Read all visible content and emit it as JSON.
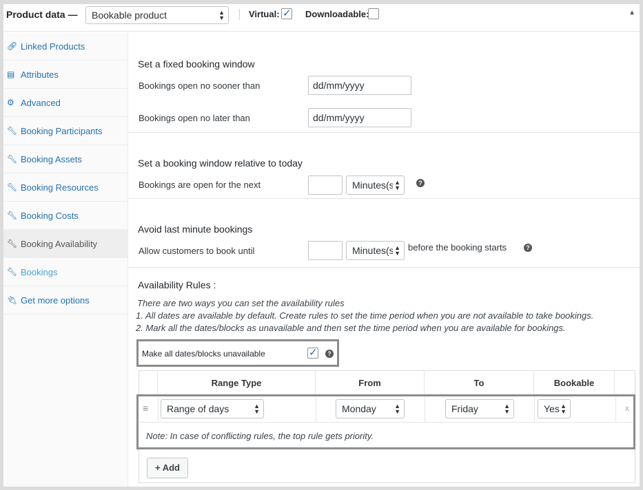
{
  "header": {
    "title": "Product data —",
    "product_type": "Bookable product",
    "virtual_label": "Virtual:",
    "virtual_checked": true,
    "downloadable_label": "Downloadable:",
    "downloadable_checked": false
  },
  "sidebar": {
    "items": [
      {
        "label": "Linked Products",
        "icon": "link-icon"
      },
      {
        "label": "Attributes",
        "icon": "list-icon"
      },
      {
        "label": "Advanced",
        "icon": "gear-icon"
      },
      {
        "label": "Booking Participants",
        "icon": "wrench-icon"
      },
      {
        "label": "Booking Assets",
        "icon": "wrench-icon"
      },
      {
        "label": "Booking Resources",
        "icon": "wrench-icon"
      },
      {
        "label": "Booking Costs",
        "icon": "wrench-icon"
      },
      {
        "label": "Booking Availability",
        "icon": "wrench-icon"
      },
      {
        "label": "Bookings",
        "icon": "wrench-icon"
      },
      {
        "label": "Get more options",
        "icon": "plugin-icon"
      }
    ],
    "active_index": 7
  },
  "fixed_window": {
    "title": "Set a fixed booking window",
    "open_no_sooner_label": "Bookings open no sooner than",
    "open_no_sooner_value": "dd/mm/yyyy",
    "open_no_later_label": "Bookings open no later than",
    "open_no_later_value": "dd/mm/yyyy"
  },
  "relative_window": {
    "title": "Set a booking window relative to today",
    "label": "Bookings are open for the next",
    "amount": "",
    "unit": "Minutes(s"
  },
  "last_minute": {
    "title": "Avoid last minute bookings",
    "label": "Allow customers to book until",
    "amount": "",
    "unit": "Minutes(s",
    "suffix": "before the booking starts"
  },
  "rules": {
    "title": "Availability Rules :",
    "info_line1": "There are two ways you can set the availability rules",
    "info_line2": "1. All dates are available by default. Create rules to set the time period when you are not available to take bookings.",
    "info_line3": "2. Mark all the dates/blocks as unavailable and then set the time period when you are available for bookings.",
    "make_unavailable_label": "Make all dates/blocks unavailable",
    "make_unavailable_checked": true,
    "columns": [
      "Range Type",
      "From",
      "To",
      "Bookable"
    ],
    "row": {
      "range_type": "Range of days",
      "from": "Monday",
      "to": "Friday",
      "bookable": "Yes",
      "remove": "x"
    },
    "note": "Note: In case of conflicting rules, the top rule gets priority.",
    "add_label": "+ Add"
  },
  "colors": {
    "link": "#2271b1",
    "active_text": "#555555",
    "highlight_border": "#8c8c8c"
  }
}
